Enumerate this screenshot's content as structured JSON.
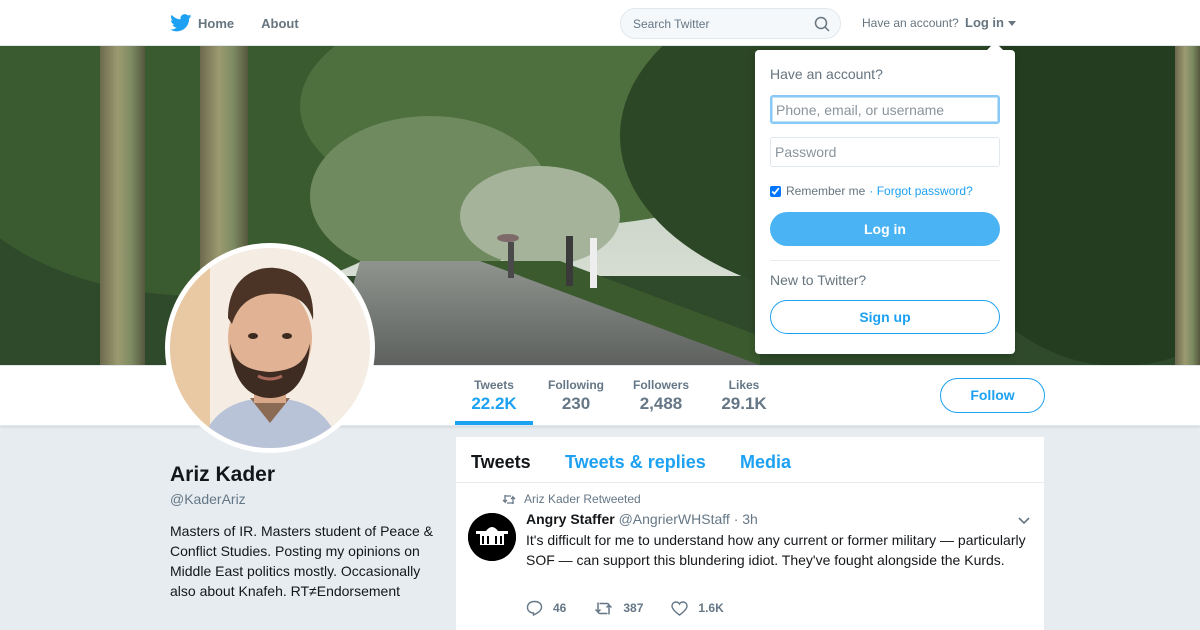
{
  "nav": {
    "home_label": "Home",
    "about_label": "About",
    "search_placeholder": "Search Twitter",
    "have_account_text": "Have an account?",
    "login_label": "Log in"
  },
  "colors": {
    "accent": "#1da1f2",
    "login_button": "#4ab3f4",
    "page_bg": "#e6ecf0"
  },
  "profile": {
    "name": "Ariz Kader",
    "handle": "@KaderAriz",
    "bio": "Masters of IR. Masters student of Peace & Conflict Studies. Posting my opinions on Middle East politics mostly. Occasionally also about Knafeh. RT≠Endorsement",
    "follow_label": "Follow"
  },
  "stats": [
    {
      "label": "Tweets",
      "value": "22.2K",
      "active": true
    },
    {
      "label": "Following",
      "value": "230",
      "active": false
    },
    {
      "label": "Followers",
      "value": "2,488",
      "active": false
    },
    {
      "label": "Likes",
      "value": "29.1K",
      "active": false
    }
  ],
  "timeline": {
    "tabs": [
      "Tweets",
      "Tweets & replies",
      "Media"
    ],
    "active_tab": "Tweets",
    "tweet": {
      "retweet_by": "Ariz Kader Retweeted",
      "author_name": "Angry Staffer",
      "author_handle": "@AngrierWHStaff",
      "time": "· 3h",
      "text": "It's difficult for me to understand how any current or former military — particularly SOF — can support this blundering idiot. They've fought alongside the Kurds.",
      "replies": "46",
      "retweets": "387",
      "likes": "1.6K"
    }
  },
  "login_dropdown": {
    "title": "Have an account?",
    "username_placeholder": "Phone, email, or username",
    "password_placeholder": "Password",
    "remember_label": "Remember me",
    "remember_checked": true,
    "forgot_label": "· Forgot password?",
    "login_button": "Log in",
    "new_text": "New to Twitter?",
    "signup_button": "Sign up"
  }
}
